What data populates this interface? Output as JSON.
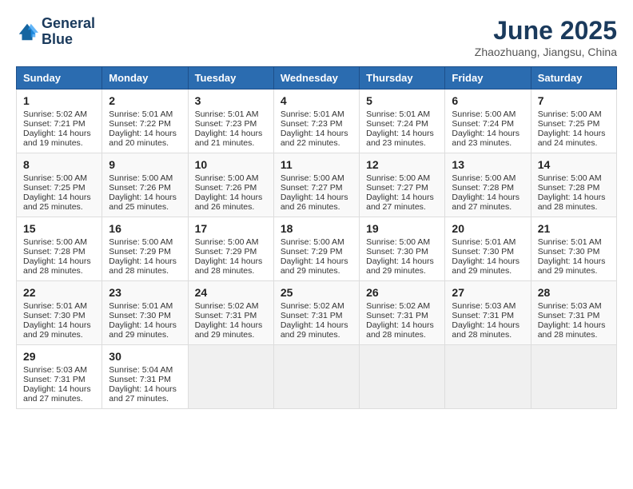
{
  "header": {
    "logo_line1": "General",
    "logo_line2": "Blue",
    "month": "June 2025",
    "location": "Zhaozhuang, Jiangsu, China"
  },
  "days_of_week": [
    "Sunday",
    "Monday",
    "Tuesday",
    "Wednesday",
    "Thursday",
    "Friday",
    "Saturday"
  ],
  "weeks": [
    [
      {
        "day": 1,
        "sunrise": "5:02 AM",
        "sunset": "7:21 PM",
        "daylight": "14 hours and 19 minutes."
      },
      {
        "day": 2,
        "sunrise": "5:01 AM",
        "sunset": "7:22 PM",
        "daylight": "14 hours and 20 minutes."
      },
      {
        "day": 3,
        "sunrise": "5:01 AM",
        "sunset": "7:23 PM",
        "daylight": "14 hours and 21 minutes."
      },
      {
        "day": 4,
        "sunrise": "5:01 AM",
        "sunset": "7:23 PM",
        "daylight": "14 hours and 22 minutes."
      },
      {
        "day": 5,
        "sunrise": "5:01 AM",
        "sunset": "7:24 PM",
        "daylight": "14 hours and 23 minutes."
      },
      {
        "day": 6,
        "sunrise": "5:00 AM",
        "sunset": "7:24 PM",
        "daylight": "14 hours and 23 minutes."
      },
      {
        "day": 7,
        "sunrise": "5:00 AM",
        "sunset": "7:25 PM",
        "daylight": "14 hours and 24 minutes."
      }
    ],
    [
      {
        "day": 8,
        "sunrise": "5:00 AM",
        "sunset": "7:25 PM",
        "daylight": "14 hours and 25 minutes."
      },
      {
        "day": 9,
        "sunrise": "5:00 AM",
        "sunset": "7:26 PM",
        "daylight": "14 hours and 25 minutes."
      },
      {
        "day": 10,
        "sunrise": "5:00 AM",
        "sunset": "7:26 PM",
        "daylight": "14 hours and 26 minutes."
      },
      {
        "day": 11,
        "sunrise": "5:00 AM",
        "sunset": "7:27 PM",
        "daylight": "14 hours and 26 minutes."
      },
      {
        "day": 12,
        "sunrise": "5:00 AM",
        "sunset": "7:27 PM",
        "daylight": "14 hours and 27 minutes."
      },
      {
        "day": 13,
        "sunrise": "5:00 AM",
        "sunset": "7:28 PM",
        "daylight": "14 hours and 27 minutes."
      },
      {
        "day": 14,
        "sunrise": "5:00 AM",
        "sunset": "7:28 PM",
        "daylight": "14 hours and 28 minutes."
      }
    ],
    [
      {
        "day": 15,
        "sunrise": "5:00 AM",
        "sunset": "7:28 PM",
        "daylight": "14 hours and 28 minutes."
      },
      {
        "day": 16,
        "sunrise": "5:00 AM",
        "sunset": "7:29 PM",
        "daylight": "14 hours and 28 minutes."
      },
      {
        "day": 17,
        "sunrise": "5:00 AM",
        "sunset": "7:29 PM",
        "daylight": "14 hours and 28 minutes."
      },
      {
        "day": 18,
        "sunrise": "5:00 AM",
        "sunset": "7:29 PM",
        "daylight": "14 hours and 29 minutes."
      },
      {
        "day": 19,
        "sunrise": "5:00 AM",
        "sunset": "7:30 PM",
        "daylight": "14 hours and 29 minutes."
      },
      {
        "day": 20,
        "sunrise": "5:01 AM",
        "sunset": "7:30 PM",
        "daylight": "14 hours and 29 minutes."
      },
      {
        "day": 21,
        "sunrise": "5:01 AM",
        "sunset": "7:30 PM",
        "daylight": "14 hours and 29 minutes."
      }
    ],
    [
      {
        "day": 22,
        "sunrise": "5:01 AM",
        "sunset": "7:30 PM",
        "daylight": "14 hours and 29 minutes."
      },
      {
        "day": 23,
        "sunrise": "5:01 AM",
        "sunset": "7:30 PM",
        "daylight": "14 hours and 29 minutes."
      },
      {
        "day": 24,
        "sunrise": "5:02 AM",
        "sunset": "7:31 PM",
        "daylight": "14 hours and 29 minutes."
      },
      {
        "day": 25,
        "sunrise": "5:02 AM",
        "sunset": "7:31 PM",
        "daylight": "14 hours and 29 minutes."
      },
      {
        "day": 26,
        "sunrise": "5:02 AM",
        "sunset": "7:31 PM",
        "daylight": "14 hours and 28 minutes."
      },
      {
        "day": 27,
        "sunrise": "5:03 AM",
        "sunset": "7:31 PM",
        "daylight": "14 hours and 28 minutes."
      },
      {
        "day": 28,
        "sunrise": "5:03 AM",
        "sunset": "7:31 PM",
        "daylight": "14 hours and 28 minutes."
      }
    ],
    [
      {
        "day": 29,
        "sunrise": "5:03 AM",
        "sunset": "7:31 PM",
        "daylight": "14 hours and 27 minutes."
      },
      {
        "day": 30,
        "sunrise": "5:04 AM",
        "sunset": "7:31 PM",
        "daylight": "14 hours and 27 minutes."
      },
      null,
      null,
      null,
      null,
      null
    ]
  ]
}
